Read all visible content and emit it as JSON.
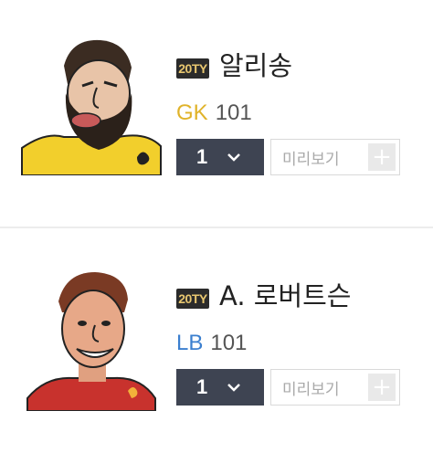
{
  "cards": [
    {
      "badge": "20TY",
      "name": "알리송",
      "position": "GK",
      "position_color": "#e0b32a",
      "rating": "101",
      "level": "1",
      "preview_label": "미리보기",
      "plus": "+",
      "portrait": "goalkeeper-caricature"
    },
    {
      "badge": "20TY",
      "name": "A. 로버트슨",
      "position": "LB",
      "position_color": "#3b7fcf",
      "rating": "101",
      "level": "1",
      "preview_label": "미리보기",
      "plus": "+",
      "portrait": "defender-caricature"
    }
  ],
  "colors": {
    "badge_bg": "#2b2b2b",
    "badge_text": "#e8c770",
    "level_bg": "#3e4452"
  },
  "icons": {
    "level_toggle": "chevron-down-icon",
    "add": "plus-icon"
  }
}
